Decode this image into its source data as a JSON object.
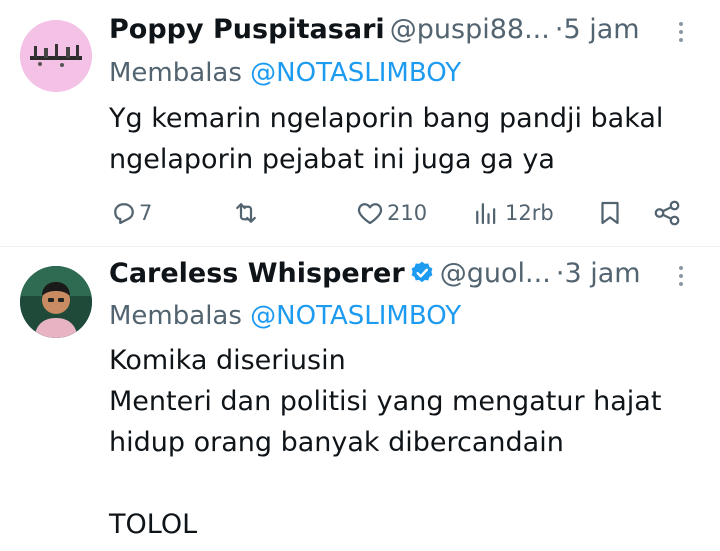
{
  "tweets": [
    {
      "name": "Poppy Puspitasari",
      "handle": "@puspi88...",
      "separator": "·",
      "time": "5 jam",
      "reply_prefix": "Membalas",
      "reply_mention": "@NOTASLIMBOY",
      "text": "Yg kemarin ngelaporin bang pandji bakal\nngelaporin pejabat ini juga ga ya",
      "stats": {
        "replies": "7",
        "reposts": "",
        "likes": "210",
        "views": "12rb"
      }
    },
    {
      "name": "Careless Whisperer",
      "verified": true,
      "handle": "@guol...",
      "separator": "·",
      "time": "3 jam",
      "reply_prefix": "Membalas",
      "reply_mention": "@NOTASLIMBOY",
      "text": "Komika diseriusin\nMenteri dan politisi yang mengatur hajat\nhidup orang banyak dibercandain\n\nTOLOL"
    }
  ],
  "colors": {
    "accent": "#1d9bf0",
    "muted": "#536471",
    "text": "#0f1419"
  },
  "icons": [
    "reply-icon",
    "repost-icon",
    "like-icon",
    "views-icon",
    "bookmark-icon",
    "share-icon",
    "more-icon",
    "verified-badge-icon"
  ]
}
